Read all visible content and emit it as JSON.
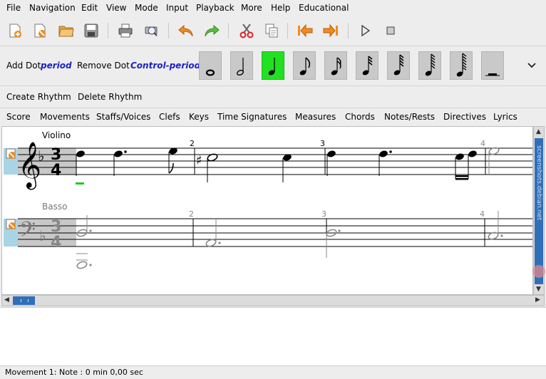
{
  "menubar": {
    "items": [
      "File",
      "Navigation",
      "Edit",
      "View",
      "Mode",
      "Input",
      "Playback",
      "More",
      "Help",
      "Educational"
    ]
  },
  "toolbar": {
    "buttons": [
      "new-icon",
      "open-template-icon",
      "open-icon",
      "save-icon",
      "print-icon",
      "print-preview-icon",
      "undo-icon",
      "redo-icon",
      "cut-icon",
      "copy-icon",
      "previous-movement-icon",
      "next-movement-icon",
      "play-icon",
      "stop-icon"
    ]
  },
  "durations": {
    "add_dot_label": "Add Dot",
    "add_dot_key": "period",
    "remove_dot_label": "Remove Dot",
    "remove_dot_key": "Control-period",
    "selected_index": 2,
    "buttons": [
      "whole-note",
      "half-note",
      "quarter-note",
      "eighth-note",
      "sixteenth-note",
      "thirty-second-note",
      "sixty-fourth-note",
      "hundred-twenty-eighth-note",
      "two-hundred-fifty-sixth-note",
      "rest"
    ]
  },
  "rhythm": {
    "create_label": "Create Rhythm",
    "delete_label": "Delete Rhythm"
  },
  "palettes": [
    "Score",
    "Movements",
    "Staffs/Voices",
    "Clefs",
    "Keys",
    "Time Signatures",
    "Measures",
    "Chords",
    "Notes/Rests",
    "Directives",
    "Lyrics"
  ],
  "score": {
    "staff1_name": "Violino",
    "staff2_name": "Basso",
    "time_top": "3",
    "time_bottom": "4",
    "measure_numbers": [
      "2",
      "3",
      "4"
    ]
  },
  "watermark": "screenshots.debian.net",
  "status": {
    "text": "Movement 1: Note : 0 min 0,00 sec"
  },
  "colors": {
    "selected_duration": "#22e022",
    "shortcut_text": "#1a22c8",
    "scroll_thumb": "#2f6fb8"
  }
}
